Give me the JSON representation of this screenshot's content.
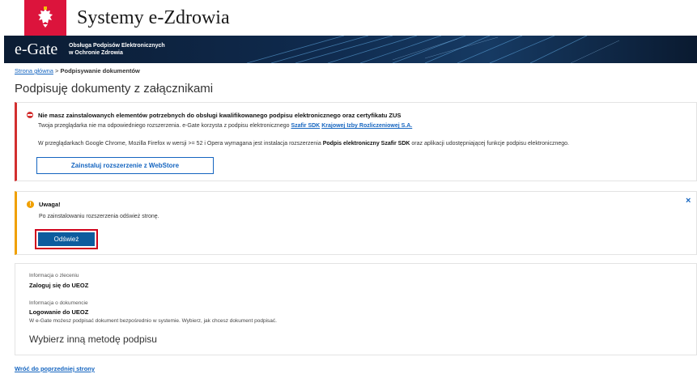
{
  "header": {
    "site_title": "Systemy e-Zdrowia",
    "flag_color": "#dc143c"
  },
  "banner": {
    "logo": "e-Gate",
    "subtitle_line1": "Obsługa Podpisów Elektronicznych",
    "subtitle_line2": "w Ochronie Zdrowia"
  },
  "breadcrumb": {
    "home": "Strona główna",
    "separator": " > ",
    "current": "Podpisywanie dokumentów"
  },
  "page_title": "Podpisuję dokumenty z załącznikami",
  "error_alert": {
    "title": "Nie masz zainstalowanych elementów potrzebnych do obsługi kwalifikowanego podpisu elektronicznego oraz certyfikatu ZUS",
    "line1_prefix": "Twoja przeglądarka nie ma odpowiedniego rozszerzenia. e-Gate korzysta z podpisu elektronicznego ",
    "line1_link1": "Szafir SDK",
    "line1_link2": "Krajowej Izby Rozliczeniowej S.A.",
    "line2_prefix": "W przeglądarkach Google Chrome, Mozilla Firefox w wersji >= 52 i Opera wymagana jest instalacja rozszerzenia ",
    "line2_bold": "Podpis elektroniczny Szafir SDK",
    "line2_suffix": " oraz aplikacji udostępniającej funkcje podpisu elektronicznego.",
    "install_button": "Zainstaluj rozszerzenie z WebStore",
    "accent": "#d32f2f"
  },
  "warning_alert": {
    "icon_glyph": "!",
    "title": "Uwaga!",
    "text": "Po zainstalowaniu rozszerzenia odśwież stronę.",
    "refresh_button": "Odśwież",
    "close_glyph": "×",
    "accent": "#f0a000"
  },
  "info": {
    "order_label": "Informacja o zleceniu",
    "order_value": "Zaloguj się do UEOZ",
    "document_label": "Informacja o dokumencie",
    "document_value": "Logowanie do UEOZ",
    "description": "W e-Gate możesz podpisać dokument bezpośrednio w systemie. Wybierz, jak chcesz dokument podpisać.",
    "other_method": "Wybierz inną metodę podpisu"
  },
  "back_link": "Wróć do poprzedniej strony"
}
